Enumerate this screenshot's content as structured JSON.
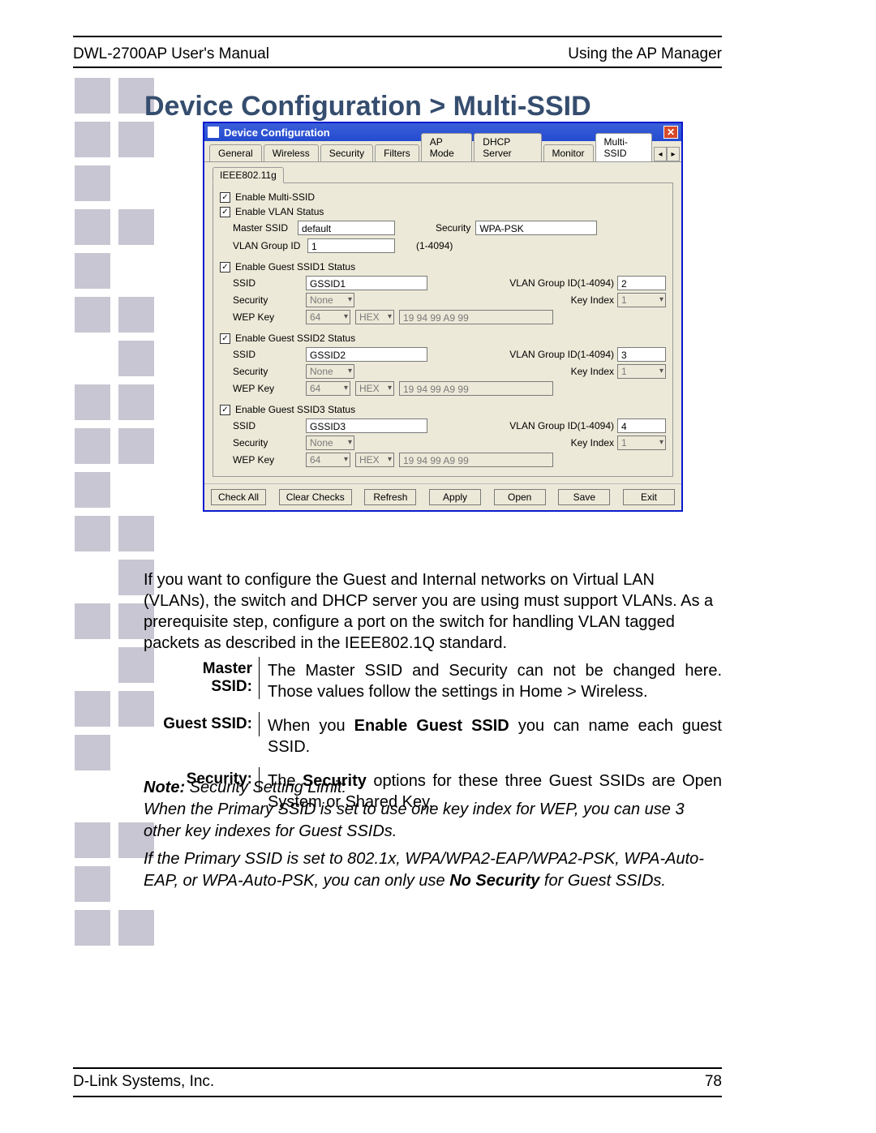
{
  "header": {
    "left": "DWL-2700AP User's Manual",
    "right": "Using the AP Manager"
  },
  "heading": "Device Configuration > Multi-SSID",
  "window": {
    "title": "Device Configuration",
    "tabs": [
      "General",
      "Wireless",
      "Security",
      "Filters",
      "AP Mode",
      "DHCP Server",
      "Monitor",
      "Multi-SSID"
    ],
    "active_tab": "Multi-SSID",
    "subtab": "IEEE802.11g",
    "enable_multi_ssid_label": "Enable Multi-SSID",
    "enable_vlan_label": "Enable VLAN Status",
    "master": {
      "ssid_label": "Master SSID",
      "ssid_value": "default",
      "security_label": "Security",
      "security_value": "WPA-PSK",
      "vlan_label": "VLAN Group ID",
      "vlan_value": "1",
      "vlan_range": "(1-4094)"
    },
    "guests": [
      {
        "enable_label": "Enable Guest SSID1 Status",
        "ssid_label": "SSID",
        "ssid_value": "GSSID1",
        "vlan_label": "VLAN Group ID(1-4094)",
        "vlan_value": "2",
        "security_label": "Security",
        "security_value": "None",
        "keyindex_label": "Key Index",
        "keyindex_value": "1",
        "wep_label": "WEP Key",
        "wep_len": "64",
        "wep_fmt": "HEX",
        "wep_value": "19 94 99 A9 99"
      },
      {
        "enable_label": "Enable Guest SSID2 Status",
        "ssid_label": "SSID",
        "ssid_value": "GSSID2",
        "vlan_label": "VLAN Group ID(1-4094)",
        "vlan_value": "3",
        "security_label": "Security",
        "security_value": "None",
        "keyindex_label": "Key Index",
        "keyindex_value": "1",
        "wep_label": "WEP Key",
        "wep_len": "64",
        "wep_fmt": "HEX",
        "wep_value": "19 94 99 A9 99"
      },
      {
        "enable_label": "Enable Guest SSID3 Status",
        "ssid_label": "SSID",
        "ssid_value": "GSSID3",
        "vlan_label": "VLAN Group ID(1-4094)",
        "vlan_value": "4",
        "security_label": "Security",
        "security_value": "None",
        "keyindex_label": "Key Index",
        "keyindex_value": "1",
        "wep_label": "WEP Key",
        "wep_len": "64",
        "wep_fmt": "HEX",
        "wep_value": "19 94 99 A9 99"
      }
    ],
    "buttons": [
      "Check All",
      "Clear Checks",
      "Refresh",
      "Apply",
      "Open",
      "Save",
      "Exit"
    ]
  },
  "paragraph": "If you want to configure the Guest and Internal networks on Virtual LAN (VLANs), the switch and DHCP server you are using must support VLANs. As a prerequisite step, configure a port on the switch for handling VLAN tagged packets as described in the IEEE802.1Q standard.",
  "defs": {
    "master_label": "Master SSID:",
    "master_text_a": "The Master SSID and Security can not be changed here. Those values follow the settings in Home > Wireless.",
    "guest_label": "Guest SSID:",
    "guest_text_a": "When you ",
    "guest_text_b": "Enable Guest SSID",
    "guest_text_c": " you can name each guest SSID.",
    "sec_label": "Security:",
    "sec_text_a": "The ",
    "sec_text_b": "Security",
    "sec_text_c": " options for these three Guest SSIDs are Open System or Shared Key."
  },
  "note": {
    "lead": "Note:",
    "l1": " Security Setting Limit:",
    "l2": "When the Primary SSID is set to use one key index for WEP, you can use 3 other key indexes for Guest SSIDs.",
    "l3a": "If the Primary SSID is set to 802.1x, WPA/WPA2-EAP/WPA2-PSK, WPA-Auto-EAP, or WPA-Auto-PSK, you can only use ",
    "l3b": "No Security",
    "l3c": " for Guest SSIDs."
  },
  "footer": {
    "left": "D-Link Systems, Inc.",
    "right": "78"
  }
}
